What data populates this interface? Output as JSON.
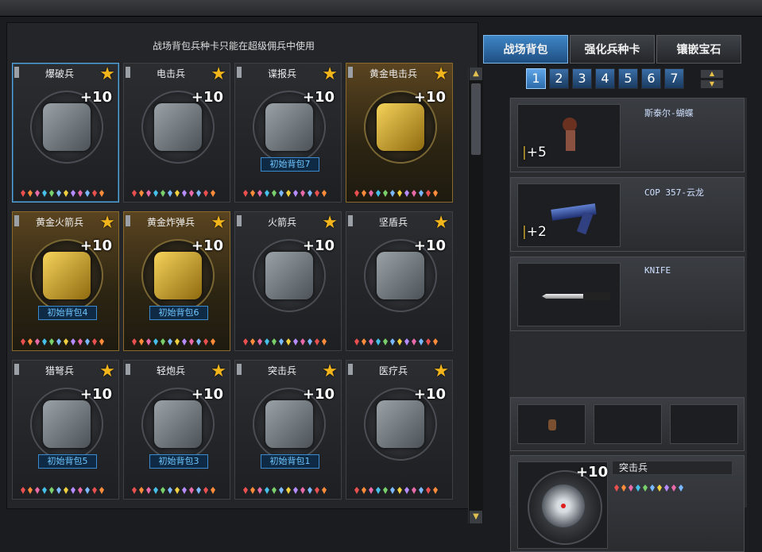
{
  "notice": "战场背包兵种卡只能在超级佣兵中使用",
  "cards": [
    {
      "title": "爆破兵",
      "plus": "+10",
      "tag": "",
      "gold": false,
      "selected": true,
      "icon": "explosive-icon"
    },
    {
      "title": "电击兵",
      "plus": "+10",
      "tag": "",
      "gold": false,
      "selected": false,
      "icon": "shock-glove-icon"
    },
    {
      "title": "谍报兵",
      "plus": "+10",
      "tag": "初始背包7",
      "gold": false,
      "selected": false,
      "icon": "mask-icon"
    },
    {
      "title": "黄金电击兵",
      "plus": "+10",
      "tag": "",
      "gold": true,
      "selected": false,
      "icon": "gold-shock-glove-icon"
    },
    {
      "title": "黄金火箭兵",
      "plus": "+10",
      "tag": "初始背包4",
      "gold": true,
      "selected": false,
      "icon": "gold-rocket-launcher-icon"
    },
    {
      "title": "黄金炸弹兵",
      "plus": "+10",
      "tag": "初始背包6",
      "gold": true,
      "selected": false,
      "icon": "gold-bomb-icon"
    },
    {
      "title": "火箭兵",
      "plus": "+10",
      "tag": "",
      "gold": false,
      "selected": false,
      "icon": "rocket-launcher-icon"
    },
    {
      "title": "坚盾兵",
      "plus": "+10",
      "tag": "",
      "gold": false,
      "selected": false,
      "icon": "shield-icon"
    },
    {
      "title": "猎弩兵",
      "plus": "+10",
      "tag": "初始背包5",
      "gold": false,
      "selected": false,
      "icon": "crossbow-icon"
    },
    {
      "title": "轻炮兵",
      "plus": "+10",
      "tag": "初始背包3",
      "gold": false,
      "selected": false,
      "icon": "mortar-icon"
    },
    {
      "title": "突击兵",
      "plus": "+10",
      "tag": "初始背包1",
      "gold": false,
      "selected": false,
      "icon": "sensor-icon"
    },
    {
      "title": "医疗兵",
      "plus": "+10",
      "tag": "",
      "gold": false,
      "selected": false,
      "icon": "medkit-icon"
    }
  ],
  "tabs": [
    {
      "label": "战场背包",
      "active": true
    },
    {
      "label": "强化兵种卡",
      "active": false
    },
    {
      "label": "镶嵌宝石",
      "active": false
    }
  ],
  "pages": [
    "1",
    "2",
    "3",
    "4",
    "5",
    "6",
    "7"
  ],
  "active_page": "1",
  "inventory": [
    {
      "name": "斯泰尔-蝴蝶",
      "count": "+5",
      "icon": "character-icon"
    },
    {
      "name": "COP 357-云龙",
      "count": "+2",
      "icon": "pistol-icon"
    },
    {
      "name": "KNIFE",
      "count": "",
      "icon": "knife-icon"
    }
  ],
  "detail": {
    "name": "突击兵",
    "plus": "+10"
  },
  "scroll": {
    "up": "▲",
    "down": "▼"
  },
  "star": "★"
}
